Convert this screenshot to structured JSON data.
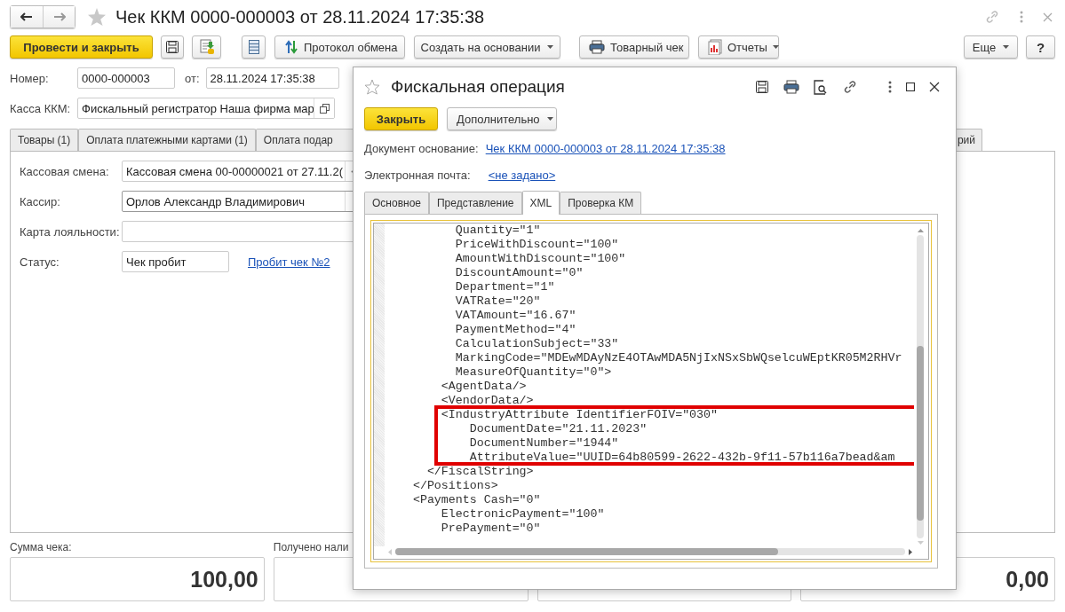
{
  "window": {
    "title": "Чек ККМ 0000-000003 от 28.11.2024 17:35:38"
  },
  "toolbar": {
    "post_close": "Провести и закрыть",
    "exchange_log": "Протокол обмена",
    "create_based_on": "Создать на основании",
    "sales_receipt": "Товарный чек",
    "reports": "Отчеты",
    "more": "Еще",
    "help": "?"
  },
  "header_fields": {
    "number_label": "Номер:",
    "number": "0000-000003",
    "date_label": "от:",
    "date": "28.11.2024 17:35:38",
    "register_label": "Касса ККМ:",
    "register": "Фискальный регистратор Наша фирма мар"
  },
  "tabs": [
    {
      "label": "Товары (1)",
      "selected": false
    },
    {
      "label": "Оплата платежными картами (1)",
      "selected": false
    },
    {
      "label": "Оплата подар",
      "selected": false
    },
    {
      "label": "рий",
      "selected": false
    }
  ],
  "tab_panel": {
    "fields": [
      {
        "label": "Кассовая смена:",
        "value": "Кассовая смена 00-00000021 от 27.11.2(",
        "kind": "choice"
      },
      {
        "label": "Кассир:",
        "value": "Орлов Александр Владимирович",
        "kind": "dropdown"
      },
      {
        "label": "Карта лояльности:",
        "kind": "text"
      },
      {
        "label": "Статус:",
        "value": "Чек пробит",
        "kind": "status",
        "link": "Пробит чек №2"
      }
    ]
  },
  "totals": [
    {
      "label": "Сумма чека:",
      "value": "100,00",
      "kind": "amount"
    },
    {
      "label": "Получено нали",
      "kind": "amount"
    },
    {
      "kind": "amount"
    },
    {
      "value": "0,00",
      "kind": "amount"
    }
  ],
  "dialog": {
    "title": "Фискальная операция",
    "close_button": "Закрыть",
    "more_button": "Дополнительно",
    "basis_label": "Документ основание:",
    "basis_link": "Чек ККМ 0000-000003 от 28.11.2024 17:35:38",
    "email_label": "Электронная почта:",
    "email_link": "<не задано>",
    "tabs": [
      {
        "label": "Основное",
        "selected": false
      },
      {
        "label": "Представление",
        "selected": false
      },
      {
        "label": "XML",
        "selected": true
      },
      {
        "label": "Проверка КМ",
        "selected": false
      }
    ],
    "xml_lines": [
      {
        "text": "          Quantity=\"1\"",
        "highlighted": false
      },
      {
        "text": "          PriceWithDiscount=\"100\"",
        "highlighted": false
      },
      {
        "text": "          AmountWithDiscount=\"100\"",
        "highlighted": false
      },
      {
        "text": "          DiscountAmount=\"0\"",
        "highlighted": false
      },
      {
        "text": "          Department=\"1\"",
        "highlighted": false
      },
      {
        "text": "          VATRate=\"20\"",
        "highlighted": false
      },
      {
        "text": "          VATAmount=\"16.67\"",
        "highlighted": false
      },
      {
        "text": "          PaymentMethod=\"4\"",
        "highlighted": false
      },
      {
        "text": "          CalculationSubject=\"33\"",
        "highlighted": false
      },
      {
        "text": "          MarkingCode=\"MDEwMDAyNzE4OTAwMDA5NjIxNSxSbWQselcuWEptKR05M2RHVr",
        "highlighted": false
      },
      {
        "text": "          MeasureOfQuantity=\"0\">",
        "highlighted": false
      },
      {
        "text": "        <AgentData/>",
        "highlighted": false
      },
      {
        "text": "        <VendorData/>",
        "highlighted": false
      },
      {
        "text": "        <IndustryAttribute IdentifierFOIV=\"030\"",
        "highlighted": true
      },
      {
        "text": "            DocumentDate=\"21.11.2023\"",
        "highlighted": true
      },
      {
        "text": "            DocumentNumber=\"1944\"",
        "highlighted": true
      },
      {
        "text": "            AttributeValue=\"UUID=64b80599-2622-432b-9f11-57b116a7bead&am",
        "highlighted": true
      },
      {
        "text": "      </FiscalString>",
        "highlighted": false
      },
      {
        "text": "    </Positions>",
        "highlighted": false
      },
      {
        "text": "    <Payments Cash=\"0\"",
        "highlighted": false
      },
      {
        "text": "        ElectronicPayment=\"100\"",
        "highlighted": false
      },
      {
        "text": "        PrePayment=\"0\"",
        "highlighted": false
      }
    ]
  }
}
